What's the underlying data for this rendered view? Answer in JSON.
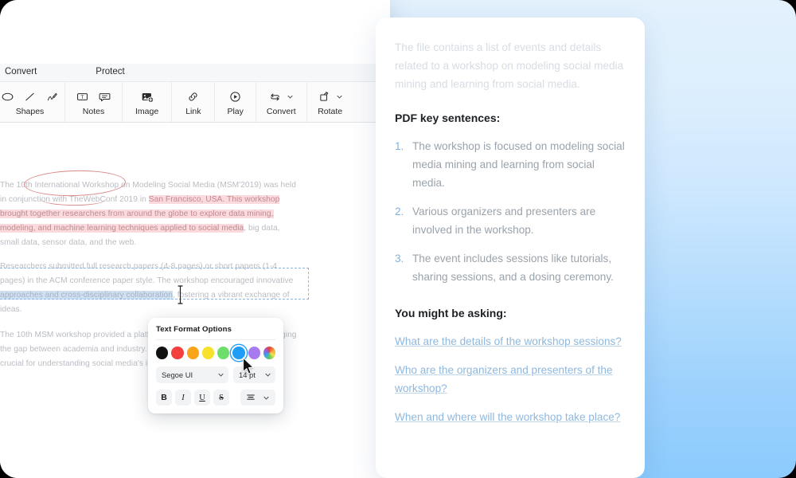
{
  "window": {
    "menu": [
      {
        "label": "Convert"
      },
      {
        "label": "Protect"
      }
    ],
    "ribbon_groups": [
      {
        "label": "Shapes",
        "icons": [
          "ellipse-icon",
          "line-icon",
          "pencil-icon"
        ]
      },
      {
        "label": "Notes",
        "icons": [
          "text-box-icon",
          "comment-icon"
        ]
      },
      {
        "label": "Image",
        "icons": [
          "add-image-icon"
        ]
      },
      {
        "label": "Link",
        "icons": [
          "link-icon"
        ]
      },
      {
        "label": "Play",
        "icons": [
          "play-icon"
        ]
      },
      {
        "label": "Convert",
        "icons": [
          "convert-icon",
          "chevron-down-icon"
        ]
      },
      {
        "label": "Rotate",
        "icons": [
          "rotate-icon",
          "chevron-down-icon"
        ]
      }
    ]
  },
  "document": {
    "paragraph1": {
      "part1": "The 10th International Workshop on Modeling Social Media (MSM'2019) was held in conjunction with TheWebConf 2019 in ",
      "highlight": "San Francisco, USA. This workshop brought together researchers from around the globe to explore data mining, modeling, and machine learning techniques applied to social media",
      "part2": ", big data, small data, sensor data, and the web."
    },
    "paragraph2": {
      "part1": "Researchers submitted full research papers (4-8 pages) or short papers (1-4 pages) in the ACM conference paper style. The workshop encouraged innovative ",
      "highlight": "approaches and cross-disciplinary collaboration",
      "part2": ", fostering a vibrant exchange of ideas."
    },
    "paragraph3": "The 10th MSM workshop provided a platform for advancing research and bridging the gap between academia and industry. The findings and these insights are crucial for understanding social media's impact."
  },
  "format_popup": {
    "title": "Text Format Options",
    "colors": [
      {
        "name": "black",
        "hex": "#111111",
        "selected": false
      },
      {
        "name": "red",
        "hex": "#f43f3f",
        "selected": false
      },
      {
        "name": "orange",
        "hex": "#f9a51a",
        "selected": false
      },
      {
        "name": "yellow",
        "hex": "#f7e12b",
        "selected": false
      },
      {
        "name": "green",
        "hex": "#6ede6a",
        "selected": false
      },
      {
        "name": "blue",
        "hex": "#1f9df7",
        "selected": true
      },
      {
        "name": "purple",
        "hex": "#a77bef",
        "selected": false
      },
      {
        "name": "rainbow",
        "hex": "rainbow",
        "selected": false
      }
    ],
    "font_family": "Segoe UI",
    "font_size": "14 pt",
    "bold_label": "B",
    "italic_label": "I",
    "underline_label": "U",
    "strikethrough_label": "S"
  },
  "ai_panel": {
    "summary": "The file contains a list of events and details related to a workshop on modeling social media mining and learning from social media.",
    "key_sentences_heading": "PDF key sentences:",
    "key_sentences": [
      {
        "num": "1.",
        "text": "The workshop is focused on modeling social media mining and learning from social media."
      },
      {
        "num": "2.",
        "text": "Various organizers and presenters are involved in the workshop."
      },
      {
        "num": "3.",
        "text": "The event includes sessions like tutorials, sharing sessions, and a dosing ceremony."
      }
    ],
    "questions_heading": "You might be asking:",
    "questions": [
      "What are the details of the workshop sessions?",
      "Who are the organizers and presenters of the workshop?",
      "When and where will the workshop take place?"
    ]
  },
  "colors": {
    "accent": "#1f9df7",
    "highlight_pink": "#fadadd",
    "highlight_blue": "#cfe0f2",
    "annotation_red": "#d98a8a",
    "background_top": "#e3f1fd",
    "background_bottom": "#8ccbfd"
  }
}
